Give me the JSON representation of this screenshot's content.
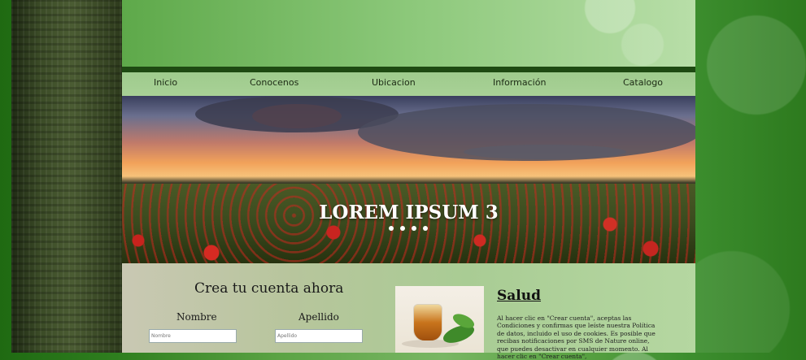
{
  "nav": {
    "items": [
      "Inicio",
      "Conocenos",
      "Ubicacion",
      "Información",
      "Catalogo"
    ]
  },
  "banner": {
    "title": "LOREM IPSUM 3",
    "slide_count": 4
  },
  "signup": {
    "title": "Crea tu cuenta ahora",
    "first_name_label": "Nombre",
    "last_name_label": "Apellido",
    "first_name_placeholder": "Nombre",
    "last_name_placeholder": "Apellido"
  },
  "section": {
    "title": "Salud",
    "body": "Al hacer clic en \"Crear cuenta\", aceptas las Condiciones y confirmas que leíste nuestra Política de datos, incluido el uso de cookies. Es posible que recibas notificaciones por SMS de Nature online, que puedes desactivar en cualquier momento. Al hacer clic en \"Crear cuenta\","
  }
}
